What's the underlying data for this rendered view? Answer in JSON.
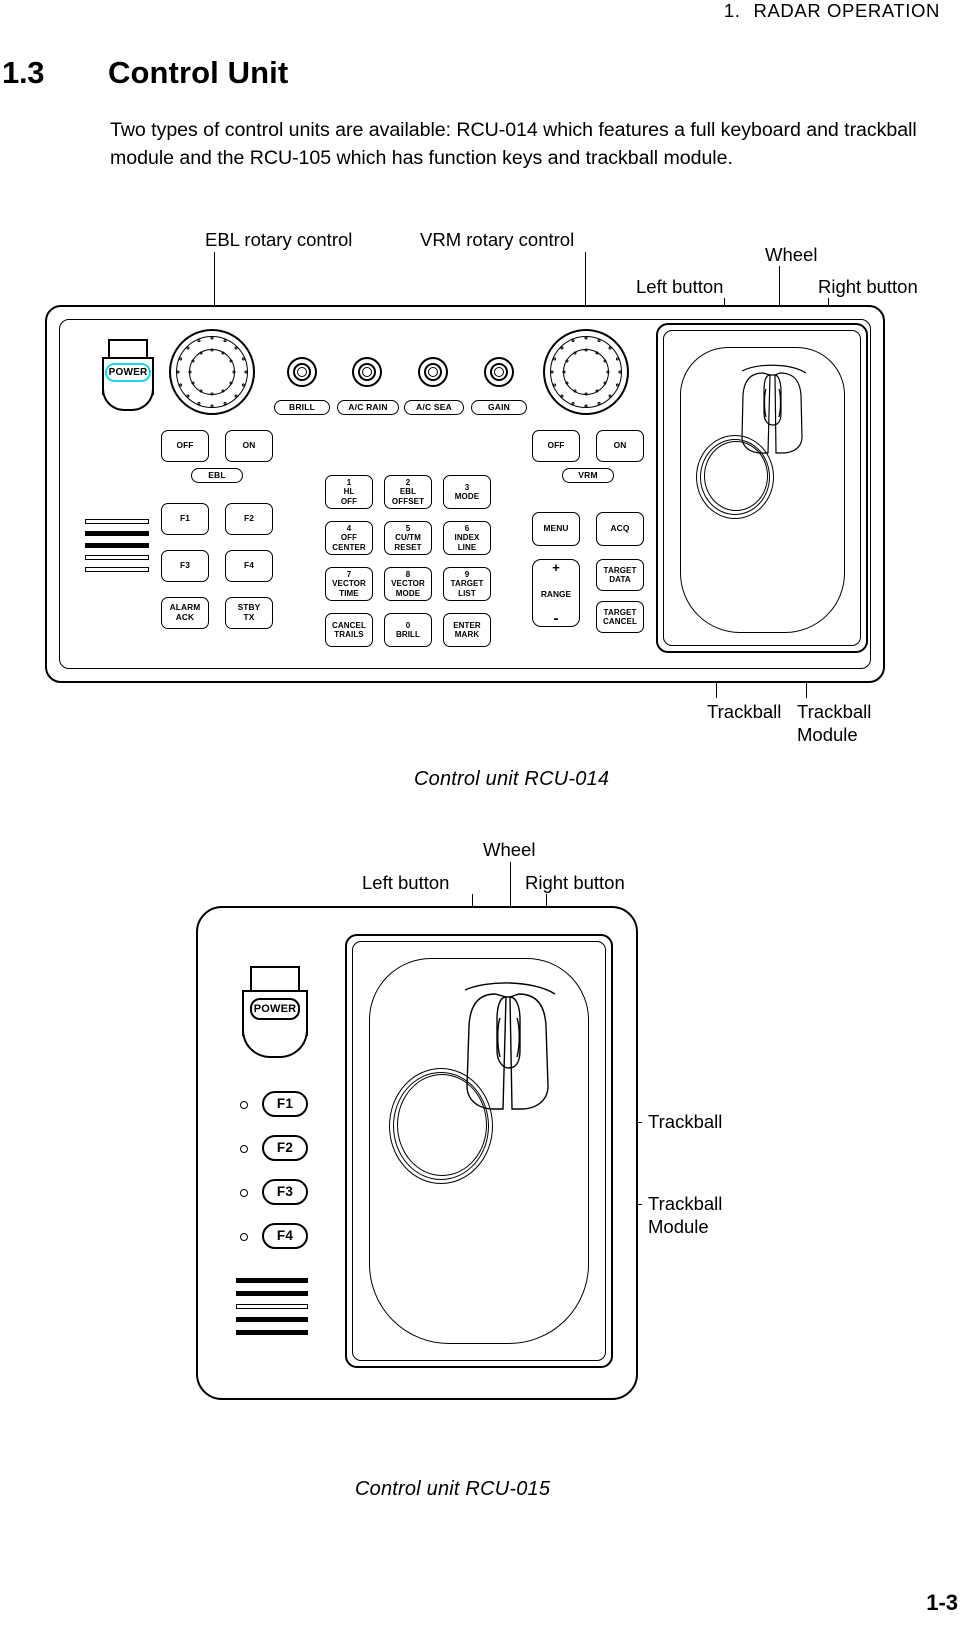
{
  "header": {
    "chapter_number": "1.",
    "chapter_title": "RADAR  OPERATION"
  },
  "section": {
    "number": "1.3",
    "title": "Control Unit",
    "body": "Two types of control units are available: RCU-014 which features a full keyboard and trackball module and the RCU-105 which has function keys and trackball module."
  },
  "figure1": {
    "caption": "Control unit RCU-014",
    "callouts": {
      "ebl_rotary": "EBL rotary control",
      "vrm_rotary": "VRM rotary control",
      "left_button": "Left button",
      "wheel": "Wheel",
      "right_button": "Right button",
      "trackball": "Trackball",
      "trackball_module": "Trackball\nModule"
    },
    "power": {
      "label": "POWER",
      "accent_color": "#19d6e8"
    },
    "knob_legends": [
      "BRILL",
      "A/C RAIN",
      "A/C SEA",
      "GAIN"
    ],
    "ebl_group": {
      "off": "OFF",
      "on": "ON",
      "legend": "EBL"
    },
    "vrm_group": {
      "off": "OFF",
      "on": "ON",
      "legend": "VRM"
    },
    "function_keys": [
      "F1",
      "F2",
      "F3",
      "F4"
    ],
    "left_keys": [
      {
        "line1": "ALARM",
        "line2": "ACK"
      },
      {
        "line1": "STBY",
        "line2": "TX"
      }
    ],
    "numeric_keys": [
      {
        "num": "1",
        "line1": "HL",
        "line2": "OFF"
      },
      {
        "num": "2",
        "line1": "EBL",
        "line2": "OFFSET"
      },
      {
        "num": "3",
        "line1": "MODE",
        "line2": ""
      },
      {
        "num": "4",
        "line1": "OFF",
        "line2": "CENTER"
      },
      {
        "num": "5",
        "line1": "CU/TM",
        "line2": "RESET"
      },
      {
        "num": "6",
        "line1": "INDEX",
        "line2": "LINE"
      },
      {
        "num": "7",
        "line1": "VECTOR",
        "line2": "TIME"
      },
      {
        "num": "8",
        "line1": "VECTOR",
        "line2": "MODE"
      },
      {
        "num": "9",
        "line1": "TARGET",
        "line2": "LIST"
      },
      {
        "num": "",
        "line1": "CANCEL",
        "line2": "TRAILS"
      },
      {
        "num": "0",
        "line1": "BRILL",
        "line2": ""
      },
      {
        "num": "",
        "line1": "ENTER",
        "line2": "MARK"
      }
    ],
    "right_keys": [
      {
        "label": "MENU"
      },
      {
        "label": "ACQ"
      },
      {
        "line1": "TARGET",
        "line2": "DATA"
      },
      {
        "line1": "TARGET",
        "line2": "CANCEL"
      }
    ],
    "range_key": {
      "plus": "+",
      "label": "RANGE",
      "minus": "-"
    }
  },
  "figure2": {
    "caption": "Control unit RCU-015",
    "callouts": {
      "left_button": "Left button",
      "wheel": "Wheel",
      "right_button": "Right button",
      "trackball": "Trackball",
      "trackball_module": "Trackball\nModule"
    },
    "power": {
      "label": "POWER"
    },
    "function_keys": [
      "F1",
      "F2",
      "F3",
      "F4"
    ]
  },
  "footer": {
    "page_number": "1-3"
  }
}
